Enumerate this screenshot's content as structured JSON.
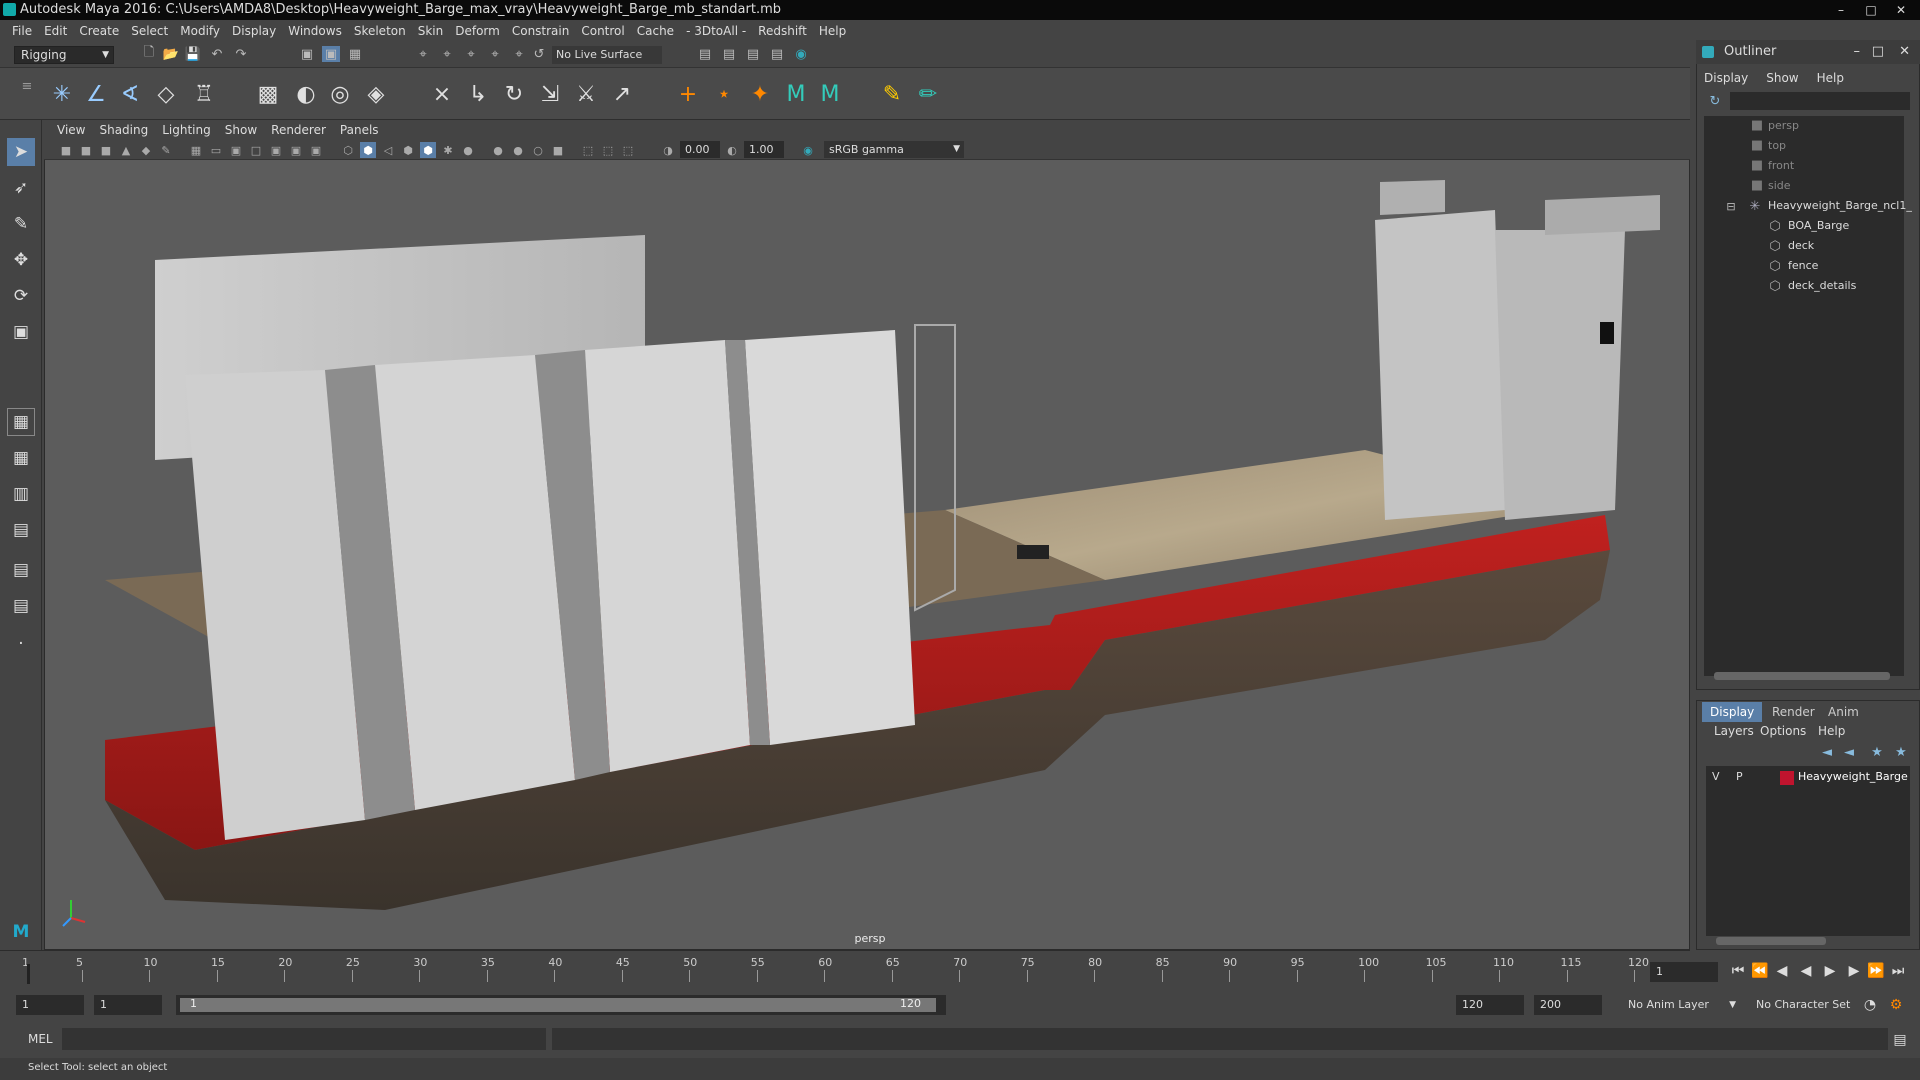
{
  "window": {
    "title": "Autodesk Maya 2016: C:\\Users\\AMDA8\\Desktop\\Heavyweight_Barge_max_vray\\Heavyweight_Barge_mb_standart.mb"
  },
  "menubar": [
    "File",
    "Edit",
    "Create",
    "Select",
    "Modify",
    "Display",
    "Windows",
    "Skeleton",
    "Skin",
    "Deform",
    "Constrain",
    "Control",
    "Cache",
    "- 3DtoAll -",
    "Redshift",
    "Help"
  ],
  "status": {
    "mode": "Rigging",
    "live_surface": "No Live Surface"
  },
  "viewport": {
    "menu": [
      "View",
      "Shading",
      "Lighting",
      "Show",
      "Renderer",
      "Panels"
    ],
    "near_value": "0.00",
    "far_value": "1.00",
    "color_space": "sRGB gamma",
    "camera_label": "persp"
  },
  "outliner": {
    "title": "Outliner",
    "menu": [
      "Display",
      "Show",
      "Help"
    ],
    "cameras": [
      "persp",
      "top",
      "front",
      "side"
    ],
    "group": "Heavyweight_Barge_ncl1_",
    "children": [
      "BOA_Barge",
      "deck",
      "fence",
      "deck_details"
    ]
  },
  "layers": {
    "tabs": [
      "Display",
      "Render",
      "Anim"
    ],
    "menu": [
      "Layers",
      "Options",
      "Help"
    ],
    "layer": {
      "v": "V",
      "p": "P",
      "name": "Heavyweight_Barge",
      "color": "#c0142e"
    }
  },
  "timeline": {
    "ticks": [
      "1",
      "5",
      "10",
      "15",
      "20",
      "25",
      "30",
      "35",
      "40",
      "45",
      "50",
      "55",
      "60",
      "65",
      "70",
      "75",
      "80",
      "85",
      "90",
      "95",
      "100",
      "105",
      "110",
      "115",
      "120"
    ],
    "current_frame": "1"
  },
  "range": {
    "start": "1",
    "playback_start": "1",
    "slider_start": "1",
    "slider_end": "120",
    "playback_end": "120",
    "end": "200",
    "anim_layer": "No Anim Layer",
    "character_set": "No Character Set"
  },
  "cmd": {
    "label": "MEL"
  },
  "help": {
    "text": "Select Tool: select an object"
  }
}
